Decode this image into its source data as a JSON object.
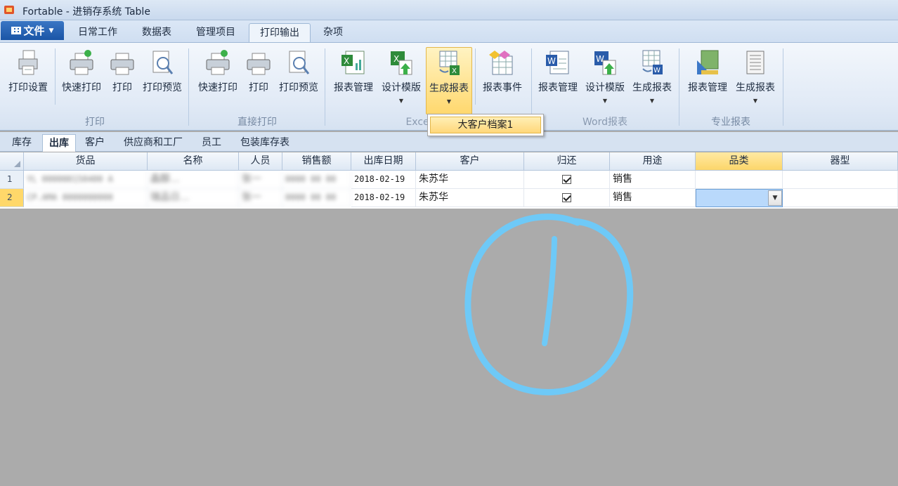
{
  "window": {
    "title": "Fortable - 进销存系统 Table"
  },
  "file_menu": {
    "label": "文件"
  },
  "ribbon_tabs": [
    {
      "label": "日常工作"
    },
    {
      "label": "数据表"
    },
    {
      "label": "管理项目"
    },
    {
      "label": "打印输出",
      "active": true
    },
    {
      "label": "杂项"
    }
  ],
  "ribbon": {
    "print_group": {
      "label": "打印",
      "setup": "打印设置",
      "quick": "快速打印",
      "print": "打印",
      "preview": "打印预览"
    },
    "direct_group": {
      "label": "直接打印",
      "quick": "快速打印",
      "print": "打印",
      "preview": "打印预览"
    },
    "excel_group": {
      "label": "Excel报表",
      "manage": "报表管理",
      "design": "设计模版",
      "generate": "生成报表",
      "events": "报表事件"
    },
    "word_group": {
      "label": "Word报表",
      "manage": "报表管理",
      "design": "设计模版",
      "generate": "生成报表"
    },
    "pro_group": {
      "label": "专业报表",
      "manage": "报表管理",
      "generate": "生成报表"
    }
  },
  "generate_popup": {
    "item": "大客户档案1"
  },
  "sheet_tabs": [
    {
      "label": "库存"
    },
    {
      "label": "出库",
      "active": true
    },
    {
      "label": "客户"
    },
    {
      "label": "供应商和工厂"
    },
    {
      "label": "员工"
    },
    {
      "label": "包装库存表"
    }
  ],
  "grid": {
    "columns": [
      "货品",
      "名称",
      "人员",
      "销售额",
      "出库日期",
      "客户",
      "归还",
      "用途",
      "品类",
      "器型"
    ],
    "rows": [
      {
        "num": "1",
        "product": "YL 000000150400 A",
        "name": "晶醇...",
        "staff": "张一",
        "sales": "0000 00 00",
        "date": "2018-02-19",
        "customer": "朱苏华",
        "returned": true,
        "usage": "销售",
        "category": "",
        "type": ""
      },
      {
        "num": "2",
        "product": "CP.AMA 0000000000",
        "name": "瑞品日...",
        "staff": "张一",
        "sales": "0000 00 00",
        "date": "2018-02-19",
        "customer": "朱苏华",
        "returned": true,
        "usage": "销售",
        "category": "",
        "type": ""
      }
    ]
  },
  "colors": {
    "accent_blue": "#1a55a6",
    "selection_yellow": "#ffd86a",
    "annotation": "#6ec9f7",
    "background_gray": "#ababab"
  }
}
